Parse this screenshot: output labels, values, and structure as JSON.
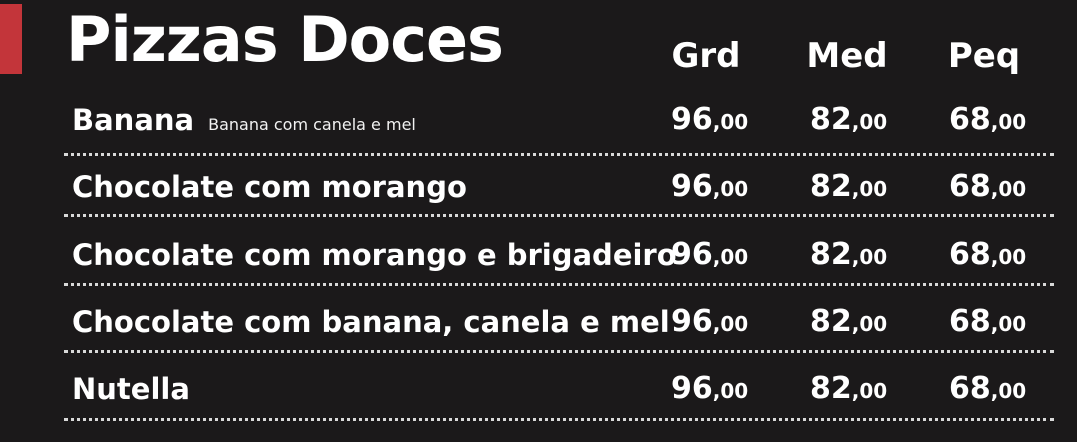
{
  "title": "Pizzas Doces",
  "accent_color": "#c3353a",
  "columns": [
    "Grd",
    "Med",
    "Peq"
  ],
  "items": [
    {
      "name": "Banana",
      "description": "Banana com canela e mel",
      "prices": [
        {
          "int": "96",
          "dec": ",00"
        },
        {
          "int": "82",
          "dec": ",00"
        },
        {
          "int": "68",
          "dec": ",00"
        }
      ]
    },
    {
      "name": "Chocolate com morango",
      "description": "",
      "prices": [
        {
          "int": "96",
          "dec": ",00"
        },
        {
          "int": "82",
          "dec": ",00"
        },
        {
          "int": "68",
          "dec": ",00"
        }
      ]
    },
    {
      "name": "Chocolate com morango e brigadeiro",
      "description": "",
      "prices": [
        {
          "int": "96",
          "dec": ",00"
        },
        {
          "int": "82",
          "dec": ",00"
        },
        {
          "int": "68",
          "dec": ",00"
        }
      ]
    },
    {
      "name": "Chocolate com banana, canela e mel",
      "description": "",
      "prices": [
        {
          "int": "96",
          "dec": ",00"
        },
        {
          "int": "82",
          "dec": ",00"
        },
        {
          "int": "68",
          "dec": ",00"
        }
      ]
    },
    {
      "name": "Nutella",
      "description": "",
      "prices": [
        {
          "int": "96",
          "dec": ",00"
        },
        {
          "int": "82",
          "dec": ",00"
        },
        {
          "int": "68",
          "dec": ",00"
        }
      ]
    }
  ]
}
